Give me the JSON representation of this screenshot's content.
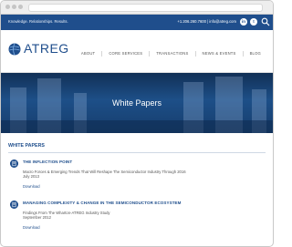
{
  "topbar": {
    "tagline": "Knowledge. Relationships. Results.",
    "contact": "+1.206.260.7600 | info@atreg.com",
    "social": [
      "in",
      "t"
    ]
  },
  "logo": {
    "text": "ATREG"
  },
  "nav": [
    "ABOUT",
    "CORE SERVICES",
    "TRANSACTIONS",
    "NEWS & EVENTS",
    "BLOG"
  ],
  "hero": {
    "title": "White Papers"
  },
  "section": {
    "title": "WHITE PAPERS"
  },
  "papers": [
    {
      "title": "THE INFLECTION POINT",
      "desc": "Macro Forces & Emerging Trends That Will Reshape The Semiconductor Industry Through 2016",
      "date": "July 2013",
      "link": "Download"
    },
    {
      "title": "MANAGING COMPLEXITY & CHANGE IN THE SEMICONDUCTOR ECOSYSTEM",
      "desc": "Findings From The Wharton-ATREG Industry Study",
      "date": "September 2012",
      "link": "Download"
    }
  ],
  "colors": {
    "brand": "#1f4e8c",
    "topbar": "#1f4e8c"
  }
}
